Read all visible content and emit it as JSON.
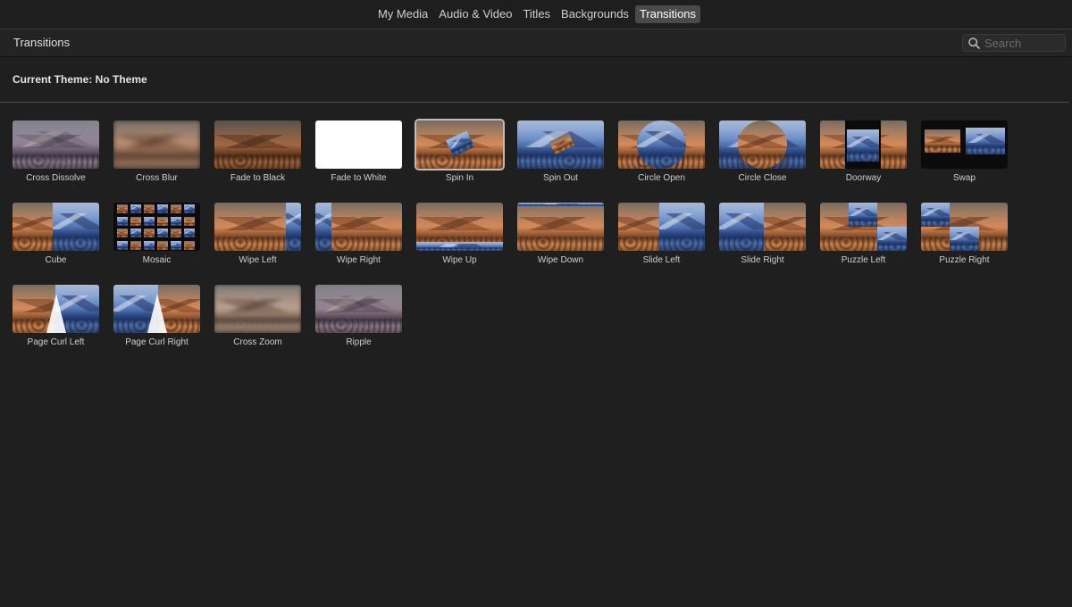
{
  "tabs": [
    {
      "label": "My Media",
      "active": false
    },
    {
      "label": "Audio & Video",
      "active": false
    },
    {
      "label": "Titles",
      "active": false
    },
    {
      "label": "Backgrounds",
      "active": false
    },
    {
      "label": "Transitions",
      "active": true
    }
  ],
  "header": {
    "title": "Transitions",
    "search_placeholder": "Search"
  },
  "theme": {
    "label": "Current Theme: No Theme"
  },
  "transitions": [
    {
      "label": "Cross Dissolve",
      "icon": "cross-dissolve-thumbnail"
    },
    {
      "label": "Cross Blur",
      "icon": "cross-blur-thumbnail"
    },
    {
      "label": "Fade to Black",
      "icon": "fade-to-black-thumbnail"
    },
    {
      "label": "Fade to White",
      "icon": "fade-to-white-thumbnail"
    },
    {
      "label": "Spin In",
      "icon": "spin-in-thumbnail",
      "selected": true
    },
    {
      "label": "Spin Out",
      "icon": "spin-out-thumbnail"
    },
    {
      "label": "Circle Open",
      "icon": "circle-open-thumbnail"
    },
    {
      "label": "Circle Close",
      "icon": "circle-close-thumbnail"
    },
    {
      "label": "Doorway",
      "icon": "doorway-thumbnail"
    },
    {
      "label": "Swap",
      "icon": "swap-thumbnail"
    },
    {
      "label": "Cube",
      "icon": "cube-thumbnail"
    },
    {
      "label": "Mosaic",
      "icon": "mosaic-thumbnail"
    },
    {
      "label": "Wipe Left",
      "icon": "wipe-left-thumbnail"
    },
    {
      "label": "Wipe Right",
      "icon": "wipe-right-thumbnail"
    },
    {
      "label": "Wipe Up",
      "icon": "wipe-up-thumbnail"
    },
    {
      "label": "Wipe Down",
      "icon": "wipe-down-thumbnail"
    },
    {
      "label": "Slide Left",
      "icon": "slide-left-thumbnail"
    },
    {
      "label": "Slide Right",
      "icon": "slide-right-thumbnail"
    },
    {
      "label": "Puzzle Left",
      "icon": "puzzle-left-thumbnail"
    },
    {
      "label": "Puzzle Right",
      "icon": "puzzle-right-thumbnail"
    },
    {
      "label": "Page Curl Left",
      "icon": "page-curl-left-thumbnail"
    },
    {
      "label": "Page Curl Right",
      "icon": "page-curl-right-thumbnail"
    },
    {
      "label": "Cross Zoom",
      "icon": "cross-zoom-thumbnail"
    },
    {
      "label": "Ripple",
      "icon": "ripple-thumbnail"
    }
  ],
  "colors": {
    "background": "#1f1f1f",
    "active_tab": "#4a4a4a",
    "selection_outline": "#bdbdbd"
  }
}
